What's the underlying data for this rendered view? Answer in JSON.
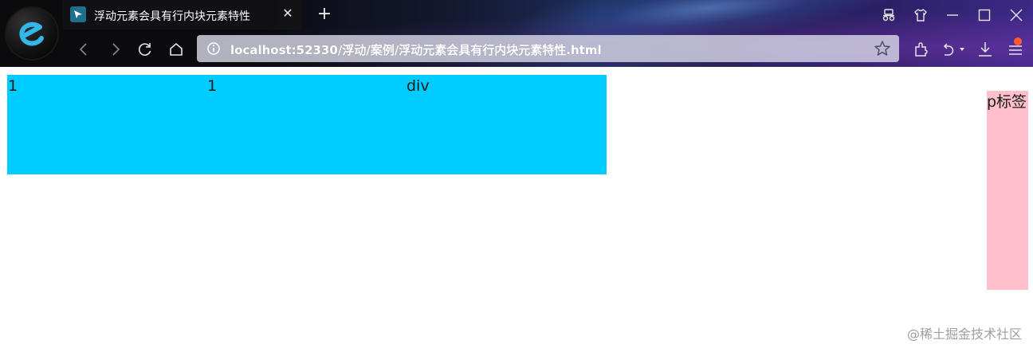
{
  "browser": {
    "tab": {
      "title": "浮动元素会具有行内块元素特性"
    },
    "address": {
      "url": "localhost:52330/浮动/案例/浮动元素会具有行内块元素特性.html"
    }
  },
  "page": {
    "floats": [
      {
        "text": "1"
      },
      {
        "text": "1"
      },
      {
        "text": "div"
      }
    ],
    "p_tag": {
      "text": "p标签"
    },
    "watermark": "@稀土掘金技术社区"
  },
  "colors": {
    "float_bg": "#00ccff",
    "p_bg": "#ffc0cb",
    "notification": "#ff5a2a"
  }
}
